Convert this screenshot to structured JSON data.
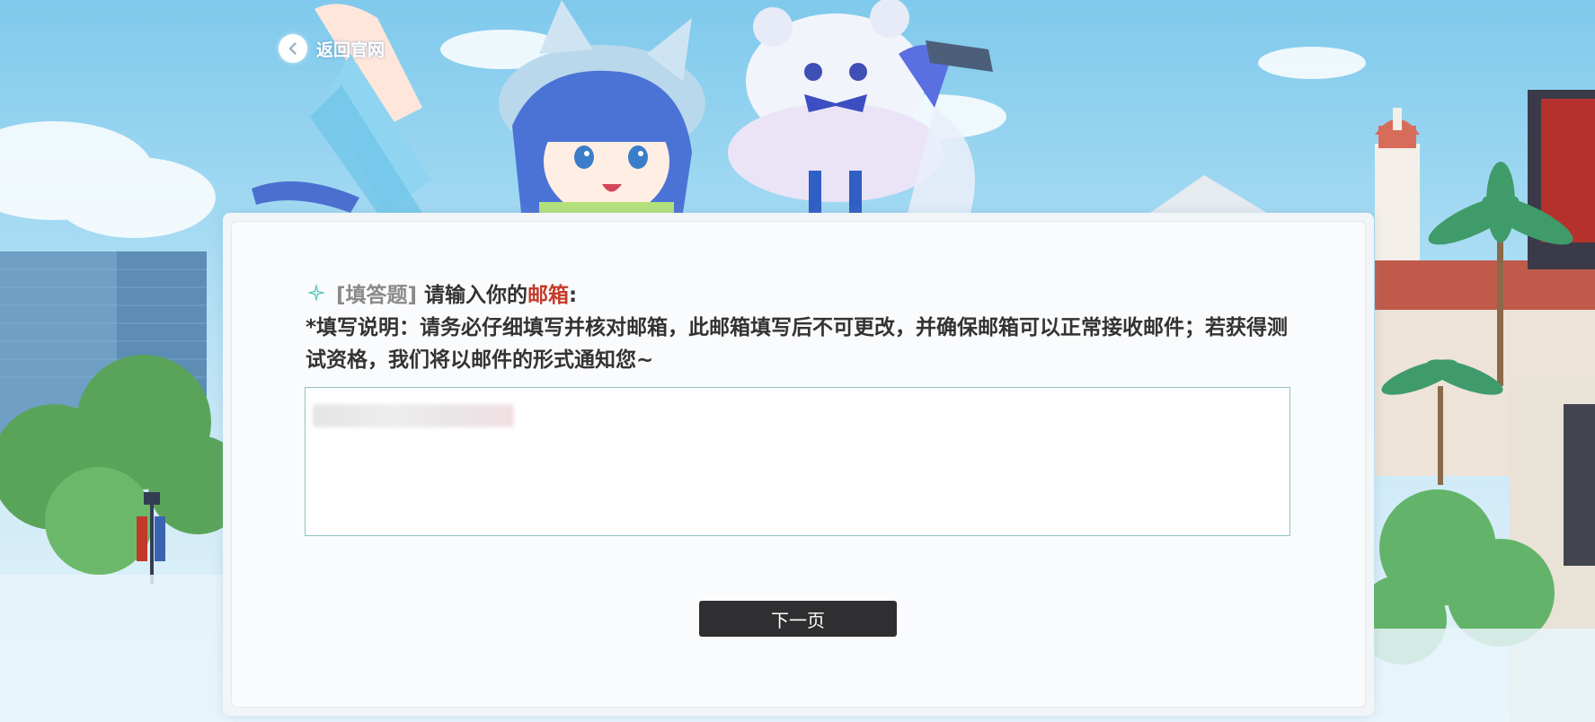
{
  "nav": {
    "back_label": "返回官网"
  },
  "question": {
    "tag": "[填答题]",
    "prompt_prefix": "请输入你的",
    "prompt_highlight": "邮箱",
    "prompt_suffix": ":",
    "instruction": "*填写说明：请务必仔细填写并核对邮箱，此邮箱填写后不可更改，并确保邮箱可以正常接收邮件；若获得测试资格，我们将以邮件的形式通知您~"
  },
  "form": {
    "next_label": "下一页"
  },
  "colors": {
    "highlight": "#c53a2a",
    "button_bg": "#2f2f31",
    "input_border": "#8fc5c0",
    "star_icon": "#3fbfb0"
  },
  "icons": {
    "back": "chevron-left-icon",
    "question_marker": "sparkle-star-icon"
  }
}
